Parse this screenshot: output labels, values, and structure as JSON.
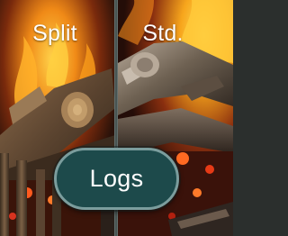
{
  "panels": [
    {
      "label": "Split",
      "image": "split-logs-fire"
    },
    {
      "label": "Std.",
      "image": "standard-logs-fire"
    }
  ],
  "button": {
    "label": "Logs"
  },
  "colors": {
    "button_fill": "#1d4a4b",
    "button_border": "#7b9d9d",
    "divider": "#6f7c7a",
    "flame": "#f7a51c",
    "ember": "#d8331f"
  }
}
